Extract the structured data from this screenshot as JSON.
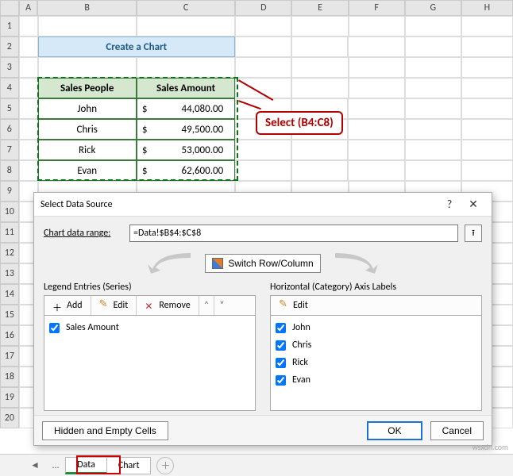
{
  "colheads": [
    "A",
    "B",
    "C",
    "D",
    "E",
    "F",
    "G",
    "H"
  ],
  "rowheads": [
    "1",
    "2",
    "3",
    "4",
    "5",
    "6",
    "7",
    "8",
    "9",
    "10",
    "11",
    "12",
    "13",
    "14",
    "15",
    "16",
    "17",
    "18",
    "19",
    "20"
  ],
  "title_banner": "Create a Chart",
  "table": {
    "h1": "Sales People",
    "h2": "Sales Amount",
    "rows": [
      {
        "name": "John",
        "currency": "$",
        "amount": "44,080.00"
      },
      {
        "name": "Chris",
        "currency": "$",
        "amount": "49,500.00"
      },
      {
        "name": "Rick",
        "currency": "$",
        "amount": "53,000.00"
      },
      {
        "name": "Evan",
        "currency": "$",
        "amount": "62,600.00"
      }
    ]
  },
  "callout": "Select (B4:C8)",
  "dialog": {
    "title": "Select Data Source",
    "range_label": "Chart data range:",
    "range_value": "=Data!$B$4:$C$8",
    "switch_label": "Switch Row/Column",
    "legend_title": "Legend Entries (Series)",
    "axis_title": "Horizontal (Category) Axis Labels",
    "btn_add": "Add",
    "btn_edit": "Edit",
    "btn_remove": "Remove",
    "series": [
      "Sales Amount"
    ],
    "categories": [
      "John",
      "Chris",
      "Rick",
      "Evan"
    ],
    "hidden_btn": "Hidden and Empty Cells",
    "ok": "OK",
    "cancel": "Cancel"
  },
  "tabs": {
    "data": "Data",
    "chart": "Chart"
  },
  "watermark": "wsxdn.com",
  "chart_data": {
    "type": "bar",
    "title": "Create a Chart",
    "categories": [
      "John",
      "Chris",
      "Rick",
      "Evan"
    ],
    "series": [
      {
        "name": "Sales Amount",
        "values": [
          44080.0,
          49500.0,
          53000.0,
          62600.0
        ]
      }
    ],
    "xlabel": "Sales People",
    "ylabel": "Sales Amount",
    "ylim": [
      0,
      70000
    ]
  }
}
